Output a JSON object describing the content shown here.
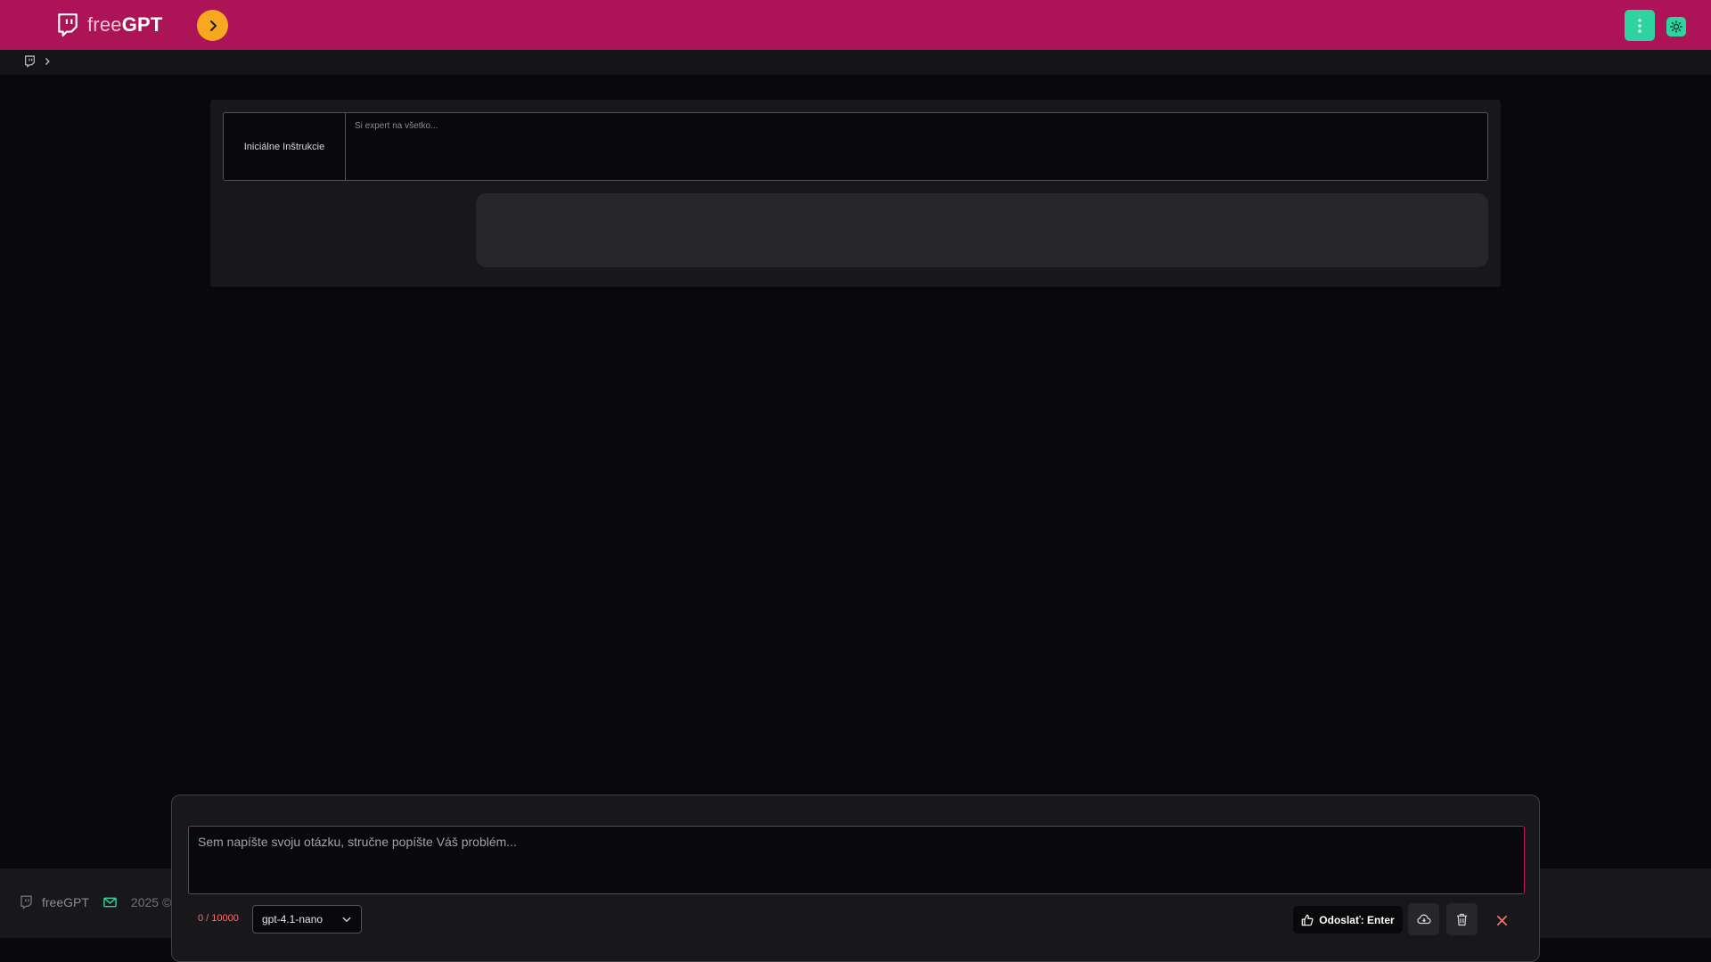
{
  "header": {
    "brand_prefix": "free",
    "brand_suffix": "GPT",
    "toggle_icon": "chevron-right-icon",
    "menu_icon": "more-vertical-icon",
    "theme_icon": "sun-icon",
    "colors": {
      "bar": "#ad1457",
      "toggle": "#f6a821",
      "accent": "#2dd4a0"
    }
  },
  "breadcrumb": {
    "home_icon": "chat-logo-icon",
    "separator_icon": "chevron-right-icon"
  },
  "instructions": {
    "label": "Iniciálne Inštrukcie",
    "placeholder": "Si expert na všetko..."
  },
  "footer": {
    "brand": "freeGPT",
    "mail_icon": "mail-icon",
    "copyright": "2025 © c"
  },
  "composer": {
    "placeholder": "Sem napíšte svoju otázku, stručne popíšte Váš problém...",
    "counter": "0 / 10000",
    "model": "gpt-4.1-nano",
    "send_label": "Odoslať: Enter",
    "send_icon": "thumbs-up-icon",
    "regenerate_icon": "cloud-icon",
    "delete_icon": "trash-icon",
    "close_icon": "close-icon"
  }
}
